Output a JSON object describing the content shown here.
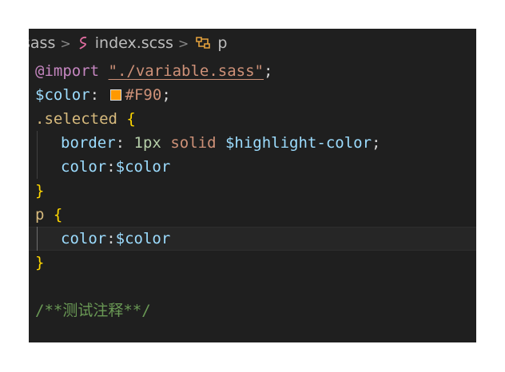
{
  "breadcrumb": {
    "parent": "sass",
    "file": "index.scss",
    "symbol": "p",
    "file_icon": "sass-file-icon",
    "symbol_icon": "selector-icon"
  },
  "colors": {
    "swatch": "#FF9900"
  },
  "code": {
    "l1": {
      "kw": "@import",
      "str": "\"./variable.sass\"",
      "end": ";"
    },
    "l2": {
      "var": "$color",
      "colon": ":",
      "val": "#F90",
      "end": ";"
    },
    "l3": {
      "sel": ".selected",
      "brace": "{"
    },
    "l4": {
      "prop": "border",
      "colon": ":",
      "num": "1px",
      "val": "solid",
      "var": "$highlight-color",
      "end": ";"
    },
    "l5": {
      "prop": "color",
      "colon": ":",
      "var": "$color"
    },
    "l6": {
      "brace": "}"
    },
    "l7": {
      "sel": "p",
      "brace": "{"
    },
    "l8": {
      "prop": "color",
      "colon": ":",
      "var": "$color"
    },
    "l9": {
      "brace": "}"
    },
    "l11": {
      "comment": "/**测试注释**/"
    }
  }
}
